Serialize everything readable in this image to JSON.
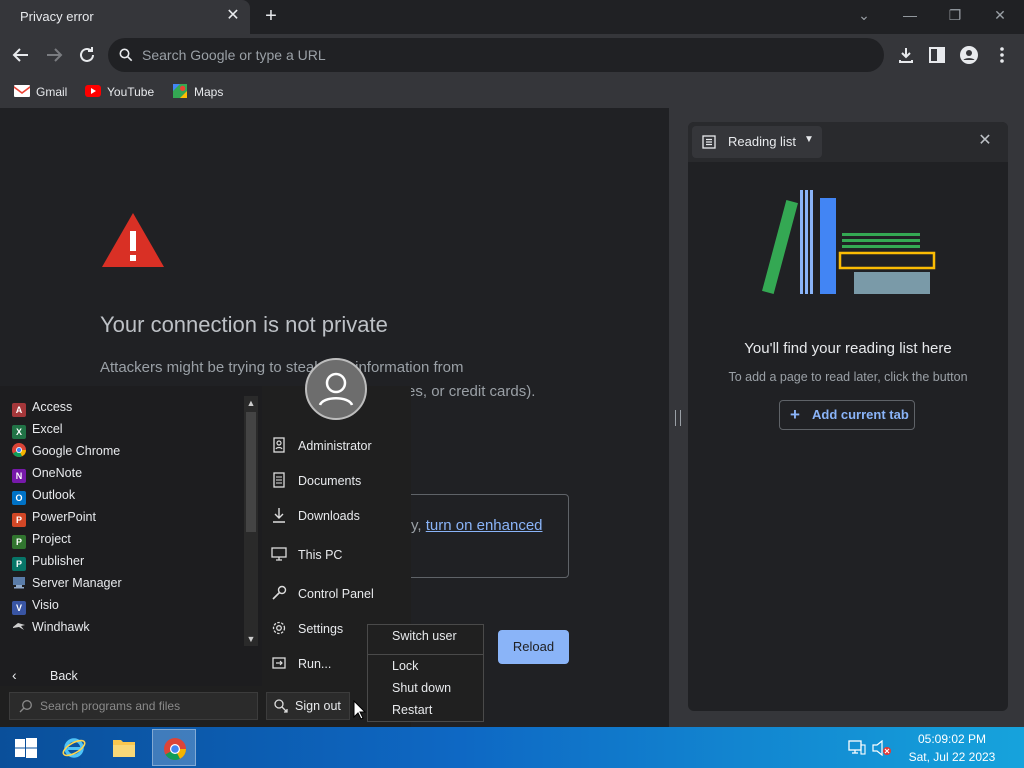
{
  "tab": {
    "title": "Privacy error"
  },
  "omnibox": {
    "placeholder": "Search Google or type a URL"
  },
  "bookmarks": [
    {
      "label": "Gmail",
      "icon": "gmail-icon"
    },
    {
      "label": "YouTube",
      "icon": "youtube-icon"
    },
    {
      "label": "Maps",
      "icon": "maps-icon"
    }
  ],
  "error_page": {
    "title": "Your connection is not private",
    "body_line1": "Attackers might be trying to steal your information from",
    "body_line2": "essages, or credit cards).",
    "enhanced_prefix": "y, ",
    "enhanced_link": "turn on enhanced",
    "reload_label": "Reload"
  },
  "side_panel": {
    "title": "Reading list",
    "empty_title": "You'll find your reading list here",
    "empty_desc": "To add a page to read later, click the button",
    "add_button": "Add current tab"
  },
  "start_menu": {
    "programs": [
      {
        "label": "Access",
        "letter": "A",
        "color": "#a4373a"
      },
      {
        "label": "Excel",
        "letter": "X",
        "color": "#217346"
      },
      {
        "label": "Google Chrome",
        "letter": "",
        "color": "#4285f4"
      },
      {
        "label": "OneNote",
        "letter": "N",
        "color": "#7719aa"
      },
      {
        "label": "Outlook",
        "letter": "O",
        "color": "#0072c6"
      },
      {
        "label": "PowerPoint",
        "letter": "P",
        "color": "#d24726"
      },
      {
        "label": "Project",
        "letter": "P",
        "color": "#31752f"
      },
      {
        "label": "Publisher",
        "letter": "P",
        "color": "#077568"
      },
      {
        "label": "Server Manager",
        "letter": "",
        "color": "#5a7ca8"
      },
      {
        "label": "Visio",
        "letter": "V",
        "color": "#3955a3"
      },
      {
        "label": "Windhawk",
        "letter": "",
        "color": "#cfcfcf"
      }
    ],
    "back_label": "Back",
    "search_placeholder": "Search programs and files",
    "right_items": [
      {
        "label": "Administrator",
        "icon": "user-folder-icon"
      },
      {
        "label": "Documents",
        "icon": "documents-icon"
      },
      {
        "label": "Downloads",
        "icon": "downloads-icon"
      },
      {
        "label": "This PC",
        "icon": "this-pc-icon"
      },
      {
        "label": "Control Panel",
        "icon": "control-panel-icon"
      },
      {
        "label": "Settings",
        "icon": "settings-icon"
      },
      {
        "label": "Run...",
        "icon": "run-icon"
      }
    ],
    "signout_label": "Sign out"
  },
  "power_menu": {
    "items": [
      "Switch user",
      "Lock",
      "Shut down",
      "Restart"
    ]
  },
  "taskbar": {
    "time": "05:09:02 PM",
    "date": "Sat, Jul 22 2023"
  }
}
